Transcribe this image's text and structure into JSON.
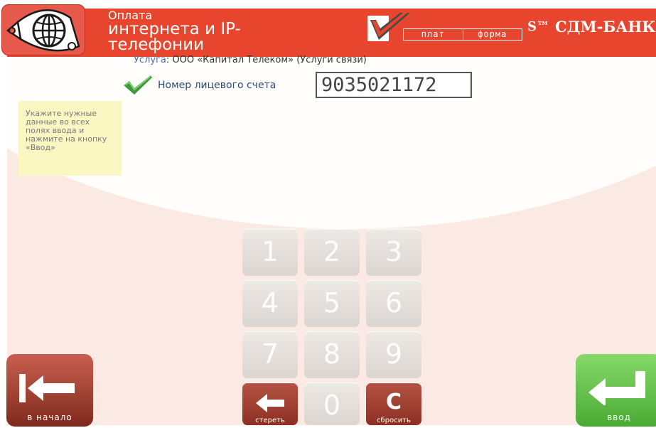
{
  "header": {
    "title_line1": "Оплата",
    "title_line2": "интернета и IP-",
    "title_line3": "телефонии",
    "logo_word_left": "плат",
    "logo_word_right": "форма",
    "bank_symbol": "S™",
    "bank_name": "СДМ-БАНК",
    "icon": "globe-icon",
    "color": "#e8452f"
  },
  "service": {
    "label": "Услуга",
    "value": ": ООО «Капитал Телеком» (Услуги связи)"
  },
  "account": {
    "label": "Номер лицевого счета",
    "value": "9035021172"
  },
  "hint": {
    "text": "Укажите нужные данные во всех полях ввода и нажмите на кнопку «Ввод»"
  },
  "keypad": {
    "k1": "1",
    "k2": "2",
    "k3": "3",
    "k4": "4",
    "k5": "5",
    "k6": "6",
    "k7": "7",
    "k8": "8",
    "k9": "9",
    "k0": "0",
    "backspace_label": "стереть",
    "clear_symbol": "C",
    "clear_label": "сбросить"
  },
  "nav": {
    "home_label": "в начало",
    "enter_label": "ввод"
  },
  "colors": {
    "accent_red": "#e8452f",
    "enter_green": "#5bbf42",
    "back_red": "#a84537"
  }
}
